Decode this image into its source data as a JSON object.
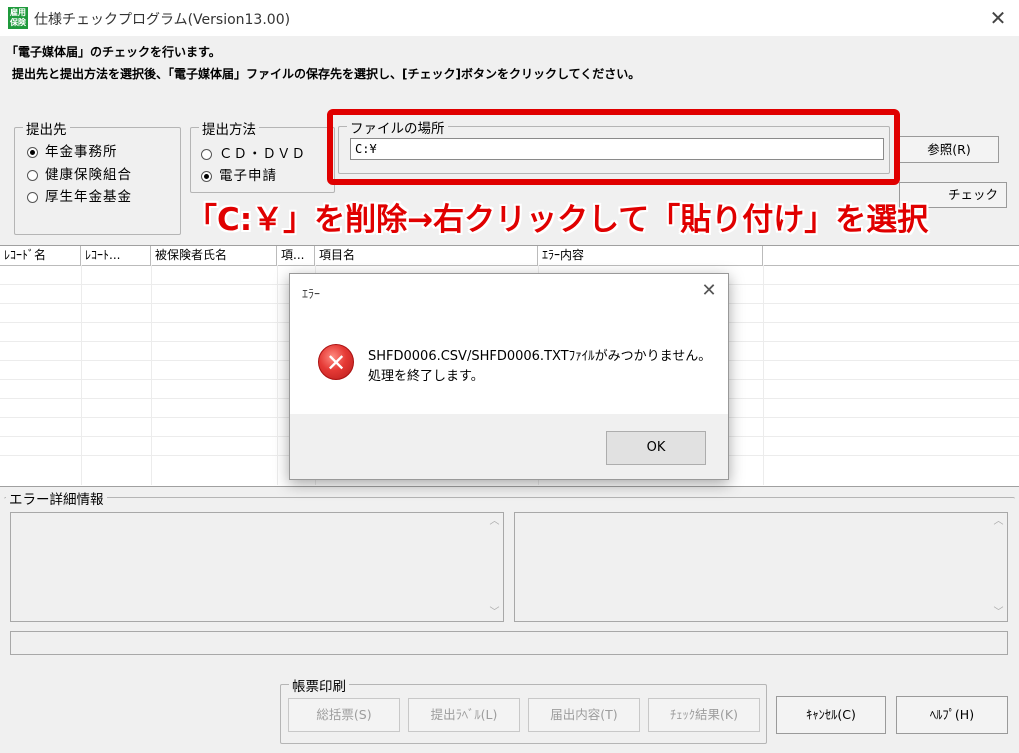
{
  "window": {
    "title": "仕様チェックプログラム(Version13.00)",
    "app_icon_text": "雇用保険",
    "close_glyph": "✕"
  },
  "instructions": {
    "line1": "「電子媒体届」のチェックを行います。",
    "line2": "提出先と提出方法を選択後、「電子媒体届」ファイルの保存先を選択し、[チェック]ボタンをクリックしてください。"
  },
  "submit_to": {
    "legend": "提出先",
    "options": [
      {
        "label": "年金事務所",
        "selected": true
      },
      {
        "label": "健康保険組合",
        "selected": false
      },
      {
        "label": "厚生年金基金",
        "selected": false
      }
    ]
  },
  "submit_method": {
    "legend": "提出方法",
    "options": [
      {
        "label": "ＣＤ・ＤＶＤ",
        "selected": false
      },
      {
        "label": "電子申請",
        "selected": true
      }
    ]
  },
  "file_location": {
    "legend": "ファイルの場所",
    "value": "C:¥",
    "browse_label": "参照(R)",
    "check_label_partial": "チェック"
  },
  "annotation": {
    "text": "「C:￥」を削除→右クリックして「貼り付け」を選択",
    "color": "#e00000"
  },
  "grid": {
    "columns": [
      "ﾚｺｰﾄﾞ名",
      "ﾚｺｰﾄ...",
      "被保険者氏名",
      "項...",
      "項目名",
      "ｴﾗｰ内容"
    ]
  },
  "dialog": {
    "title": "ｴﾗｰ",
    "icon": "error-icon",
    "message_line1": "SHFD0006.CSV/SHFD0006.TXTﾌｧｲﾙがみつかりません。",
    "message_line2": "処理を終了します。",
    "ok_label": "OK"
  },
  "error_details": {
    "legend": "エラー詳細情報"
  },
  "print": {
    "legend": "帳票印刷",
    "buttons": [
      "総括票(S)",
      "提出ﾗﾍﾞﾙ(L)",
      "届出内容(T)",
      "ﾁｪｯｸ結果(K)"
    ]
  },
  "footer": {
    "cancel_label": "ｷｬﾝｾﾙ(C)",
    "help_label": "ﾍﾙﾌﾟ(H)"
  }
}
